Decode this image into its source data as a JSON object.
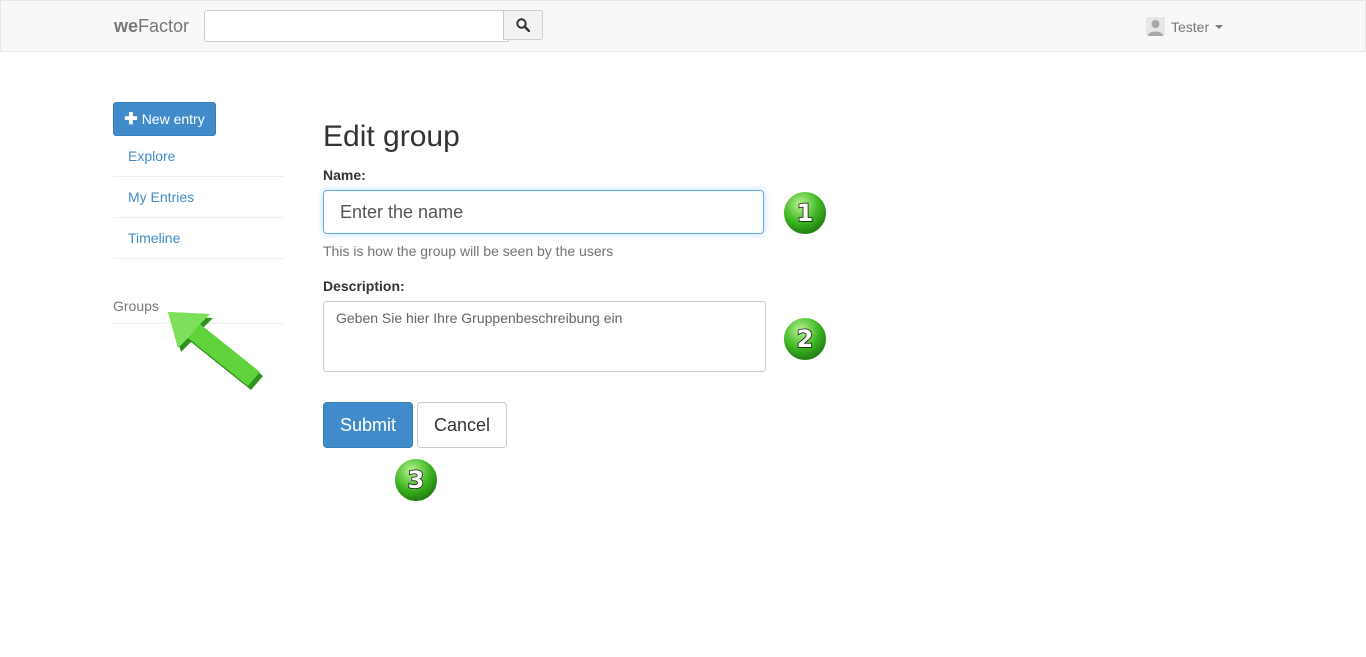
{
  "navbar": {
    "brand_bold": "we",
    "brand_rest": "Factor",
    "search_placeholder": "",
    "user_name": "Tester"
  },
  "sidebar": {
    "new_entry_label": "New entry",
    "items": [
      {
        "label": "Explore"
      },
      {
        "label": "My Entries"
      },
      {
        "label": "Timeline"
      }
    ],
    "groups_heading": "Groups"
  },
  "form": {
    "title": "Edit group",
    "name_label": "Name:",
    "name_placeholder": "Enter the name",
    "name_value": "",
    "name_help": "This is how the group will be seen by the users",
    "description_label": "Description:",
    "description_placeholder": "Geben Sie hier Ihre Gruppenbeschreibung ein",
    "submit_label": "Submit",
    "cancel_label": "Cancel"
  },
  "annotations": {
    "step1": "1",
    "step2": "2",
    "step3": "3"
  },
  "colors": {
    "primary": "#428bca",
    "link": "#428bca",
    "annotation_green": "#3cb521"
  }
}
